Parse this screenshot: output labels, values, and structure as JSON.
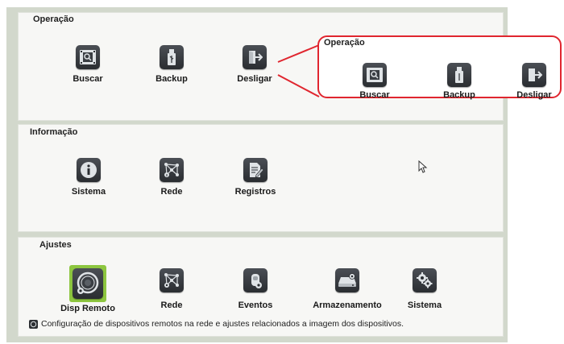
{
  "operacao": {
    "title": "Operação",
    "items": [
      {
        "label": "Buscar",
        "icon": "search-film-icon"
      },
      {
        "label": "Backup",
        "icon": "usb-drive-icon"
      },
      {
        "label": "Desligar",
        "icon": "logout-icon"
      }
    ]
  },
  "informacao": {
    "title": "Informação",
    "items": [
      {
        "label": "Sistema",
        "icon": "info-icon"
      },
      {
        "label": "Rede",
        "icon": "network-info-icon"
      },
      {
        "label": "Registros",
        "icon": "log-document-icon"
      }
    ]
  },
  "ajustes": {
    "title": "Ajustes",
    "items": [
      {
        "label": "Disp Remoto",
        "icon": "remote-camera-icon",
        "selected": true
      },
      {
        "label": "Rede",
        "icon": "network-settings-icon"
      },
      {
        "label": "Eventos",
        "icon": "events-icon"
      },
      {
        "label": "Armazenamento",
        "icon": "hard-drive-icon"
      },
      {
        "label": "Sistema",
        "icon": "gears-icon"
      }
    ],
    "description": "Configuração de dispositivos remotos na rede e ajustes relacionados a imagem dos dispositivos."
  },
  "callout": {
    "title": "Operação",
    "items": [
      {
        "label": "Buscar"
      },
      {
        "label": "Backup"
      },
      {
        "label": "Desligar"
      }
    ],
    "border_color": "#e0262f"
  },
  "colors": {
    "selected_highlight": "#8dc63f",
    "tile": "#34383d",
    "panel_bg": "#f7f7f5",
    "frame_bg": "#d2d8cc"
  }
}
